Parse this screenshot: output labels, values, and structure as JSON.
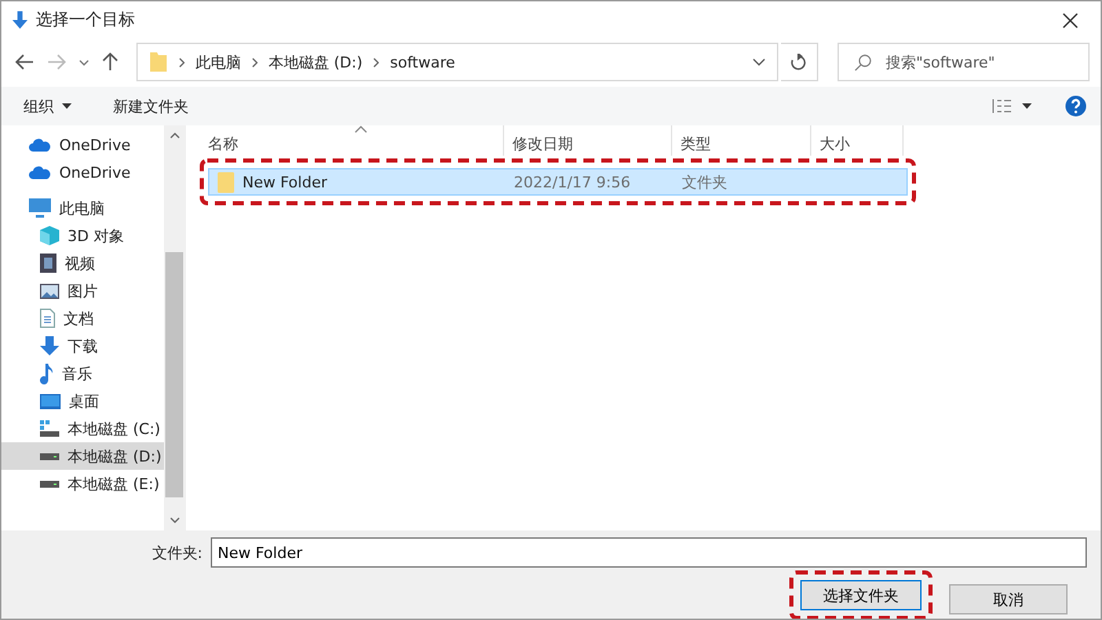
{
  "window": {
    "title": "选择一个目标"
  },
  "address": {
    "crumbs": [
      "此电脑",
      "本地磁盘 (D:)",
      "software"
    ]
  },
  "search": {
    "placeholder": "搜索\"software\""
  },
  "toolbar": {
    "organize": "组织",
    "new_folder": "新建文件夹"
  },
  "sidebar": {
    "items": [
      {
        "label": "OneDrive",
        "kind": "cloud",
        "selected": false
      },
      {
        "label": "OneDrive",
        "kind": "cloud",
        "selected": false
      },
      {
        "label": "此电脑",
        "kind": "pc",
        "selected": false,
        "children": [
          {
            "label": "3D 对象",
            "kind": "cube",
            "selected": false
          },
          {
            "label": "视频",
            "kind": "video",
            "selected": false
          },
          {
            "label": "图片",
            "kind": "image",
            "selected": false
          },
          {
            "label": "文档",
            "kind": "doc",
            "selected": false
          },
          {
            "label": "下载",
            "kind": "download",
            "selected": false
          },
          {
            "label": "音乐",
            "kind": "music",
            "selected": false
          },
          {
            "label": "桌面",
            "kind": "desktop",
            "selected": false
          },
          {
            "label": "本地磁盘 (C:)",
            "kind": "sysdrive",
            "selected": false
          },
          {
            "label": "本地磁盘 (D:)",
            "kind": "drive",
            "selected": true
          },
          {
            "label": "本地磁盘 (E:)",
            "kind": "drive",
            "selected": false
          }
        ]
      }
    ]
  },
  "table": {
    "columns": [
      "名称",
      "修改日期",
      "类型",
      "大小"
    ],
    "rows": [
      {
        "name": "New Folder",
        "date": "2022/1/17 9:56",
        "type": "文件夹",
        "selected": true
      }
    ]
  },
  "footer": {
    "label": "文件夹:",
    "value": "New Folder",
    "buttons": [
      "选择文件夹",
      "取消"
    ]
  }
}
